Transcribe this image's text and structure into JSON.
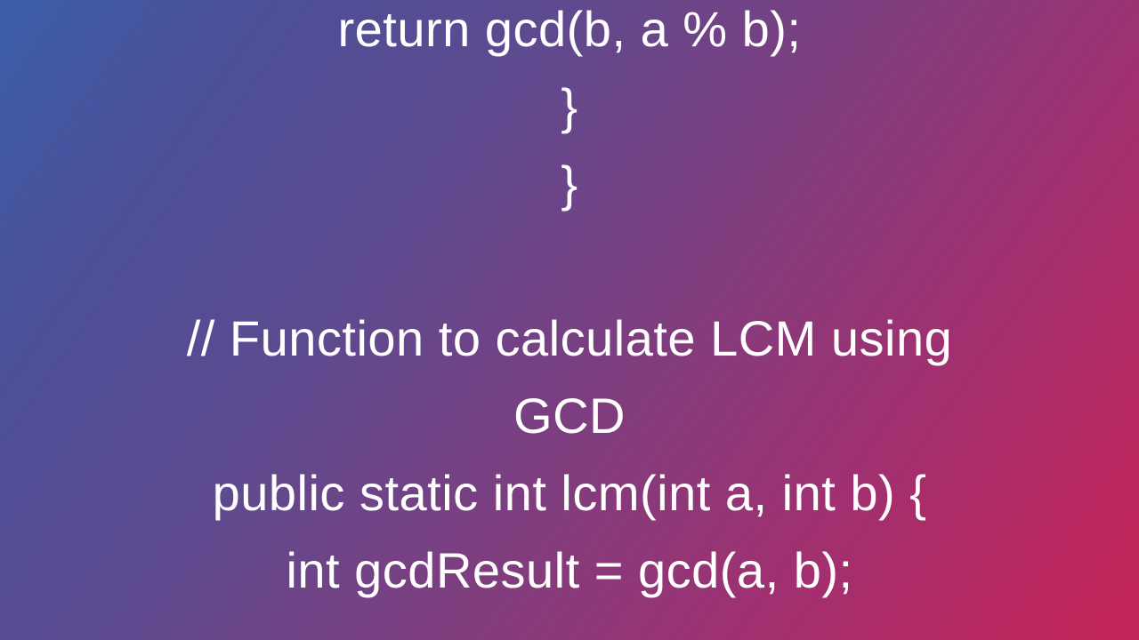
{
  "code": {
    "line1": "return gcd(b, a % b);",
    "line2": "}",
    "line3": "}",
    "line4": "// Function to calculate LCM using",
    "line5": "GCD",
    "line6": "public static int lcm(int a, int b) {",
    "line7": "int gcdResult = gcd(a, b);"
  }
}
